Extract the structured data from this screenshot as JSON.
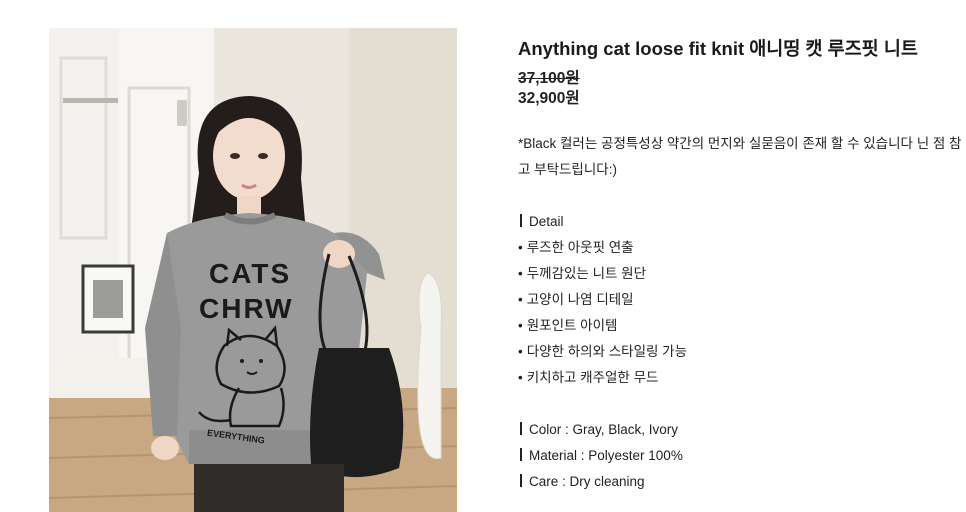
{
  "product": {
    "title": "Anything cat loose fit knit 애니띵 캣 루즈핏 니트",
    "price_original": "37,100원",
    "price_sale": "32,900원",
    "notice": "*Black 컬러는 공정특성상 약간의 먼지와 실묻음이 존재 할 수 있습니다 닌 점 참고 부탁드립니다:)",
    "detail_heading": "Detail",
    "details": [
      "루즈한 아웃핏 연출",
      "두께감있는 니트 원단",
      "고양이 나염 디테일",
      "원포인트 아이템",
      "다양한 하의와 스타일링 가능",
      "키치하고 캐주얼한 무드"
    ],
    "specs": [
      "Color : Gray, Black, Ivory",
      "Material : Polyester 100%",
      "Care : Dry cleaning"
    ],
    "sweater_print": {
      "line1": "CATS",
      "line2": "CHRW",
      "footer": "EVERYTHING"
    }
  },
  "colors": {
    "text": "#222222",
    "sweater": "#9a9a9a"
  }
}
